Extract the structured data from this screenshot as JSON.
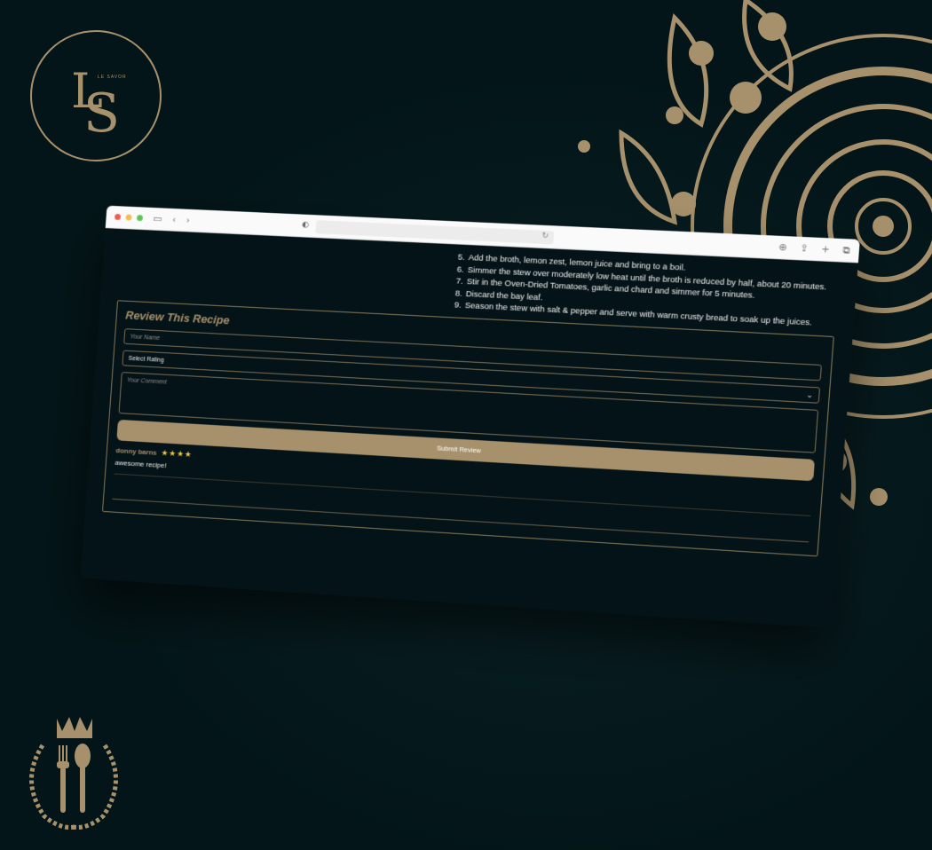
{
  "brand": {
    "logo_small_text": "LE SAVOR",
    "logo_monogram_l": "L",
    "logo_monogram_s": "S"
  },
  "browser": {
    "nav_back_icon": "chevron-left-icon",
    "nav_forward_icon": "chevron-right-icon"
  },
  "recipe": {
    "steps": [
      {
        "num": "5.",
        "text": "Add the broth, lemon zest, lemon juice and bring to a boil."
      },
      {
        "num": "6.",
        "text": "Simmer the stew over moderately low heat until the broth is reduced by half, about 20 minutes."
      },
      {
        "num": "7.",
        "text": "Stir in the Oven-Dried Tomatoes, garlic and chard and simmer for 5 minutes."
      },
      {
        "num": "8.",
        "text": "Discard the bay leaf."
      },
      {
        "num": "9.",
        "text": "Season the stew with salt & pepper and serve with warm crusty bread to soak up the juices."
      }
    ]
  },
  "review_form": {
    "title": "Review This Recipe",
    "name_placeholder": "Your Name",
    "rating_selected": "Select Rating",
    "comment_placeholder": "Your Comment",
    "submit_label": "Submit Review"
  },
  "reviews": [
    {
      "name": "donny barns",
      "stars": "★★★★",
      "rating": 4,
      "text": "awesome recipe!"
    }
  ],
  "colors": {
    "background": "#031518",
    "accent_gold": "#a7916c",
    "star": "#f2c94c"
  }
}
